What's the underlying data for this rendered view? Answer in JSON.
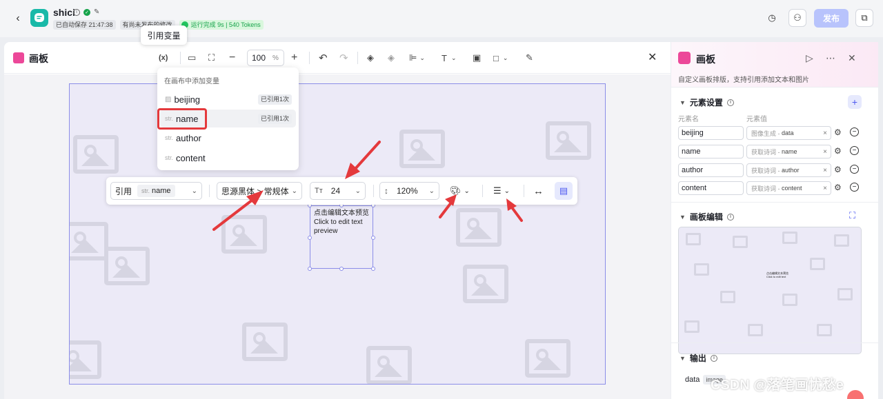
{
  "header": {
    "app_name": "shici",
    "autosave": "已自动保存 21:47:38",
    "unpublished": "有尚未发布的修改",
    "run_status": "运行完成 9s | 540 Tokens",
    "publish_label": "发布"
  },
  "canvas_panel": {
    "title": "画板",
    "zoom_value": "100",
    "zoom_unit": "%",
    "tooltip": "引用变量",
    "var_button": "(x)"
  },
  "variable_menu": {
    "heading": "在画布中添加变量",
    "items": [
      {
        "kind": "img",
        "name": "beijing",
        "count": "已引用1次"
      },
      {
        "kind": "str.",
        "name": "name",
        "count": "已引用1次"
      },
      {
        "kind": "str.",
        "name": "author",
        "count": ""
      },
      {
        "kind": "str.",
        "name": "content",
        "count": ""
      }
    ]
  },
  "text_toolbar": {
    "ref_label": "引用",
    "ref_kind": "str.",
    "ref_value": "name",
    "font": "思源黑体 > 常规体",
    "font_size": "24",
    "line_height": "120%"
  },
  "text_box": {
    "line1": "点击编辑文本预览",
    "line2": "Click to edit text",
    "line3": "preview"
  },
  "right_panel": {
    "title": "画板",
    "description": "自定义画板排版，支持引用添加文本和图片",
    "elements_title": "元素设置",
    "col_name": "元素名",
    "col_value": "元素值",
    "elements": [
      {
        "name": "beijing",
        "source": "图像生成 -",
        "var": "data"
      },
      {
        "name": "name",
        "source": "获取诗词 -",
        "var": "name"
      },
      {
        "name": "author",
        "source": "获取诗词 -",
        "var": "author"
      },
      {
        "name": "content",
        "source": "获取诗词 -",
        "var": "content"
      }
    ],
    "edit_title": "画板编辑",
    "output_title": "输出",
    "output_name": "data",
    "output_type": "image"
  },
  "watermark": "CSDN @落笔画忧愁e",
  "colors": {
    "accent": "#4e5af0",
    "publish": "#b8c3fc",
    "success": "#16a34a",
    "annotation_red": "#e4393c",
    "brand_pink": "#ec4899",
    "app_teal": "#19b9a8"
  }
}
